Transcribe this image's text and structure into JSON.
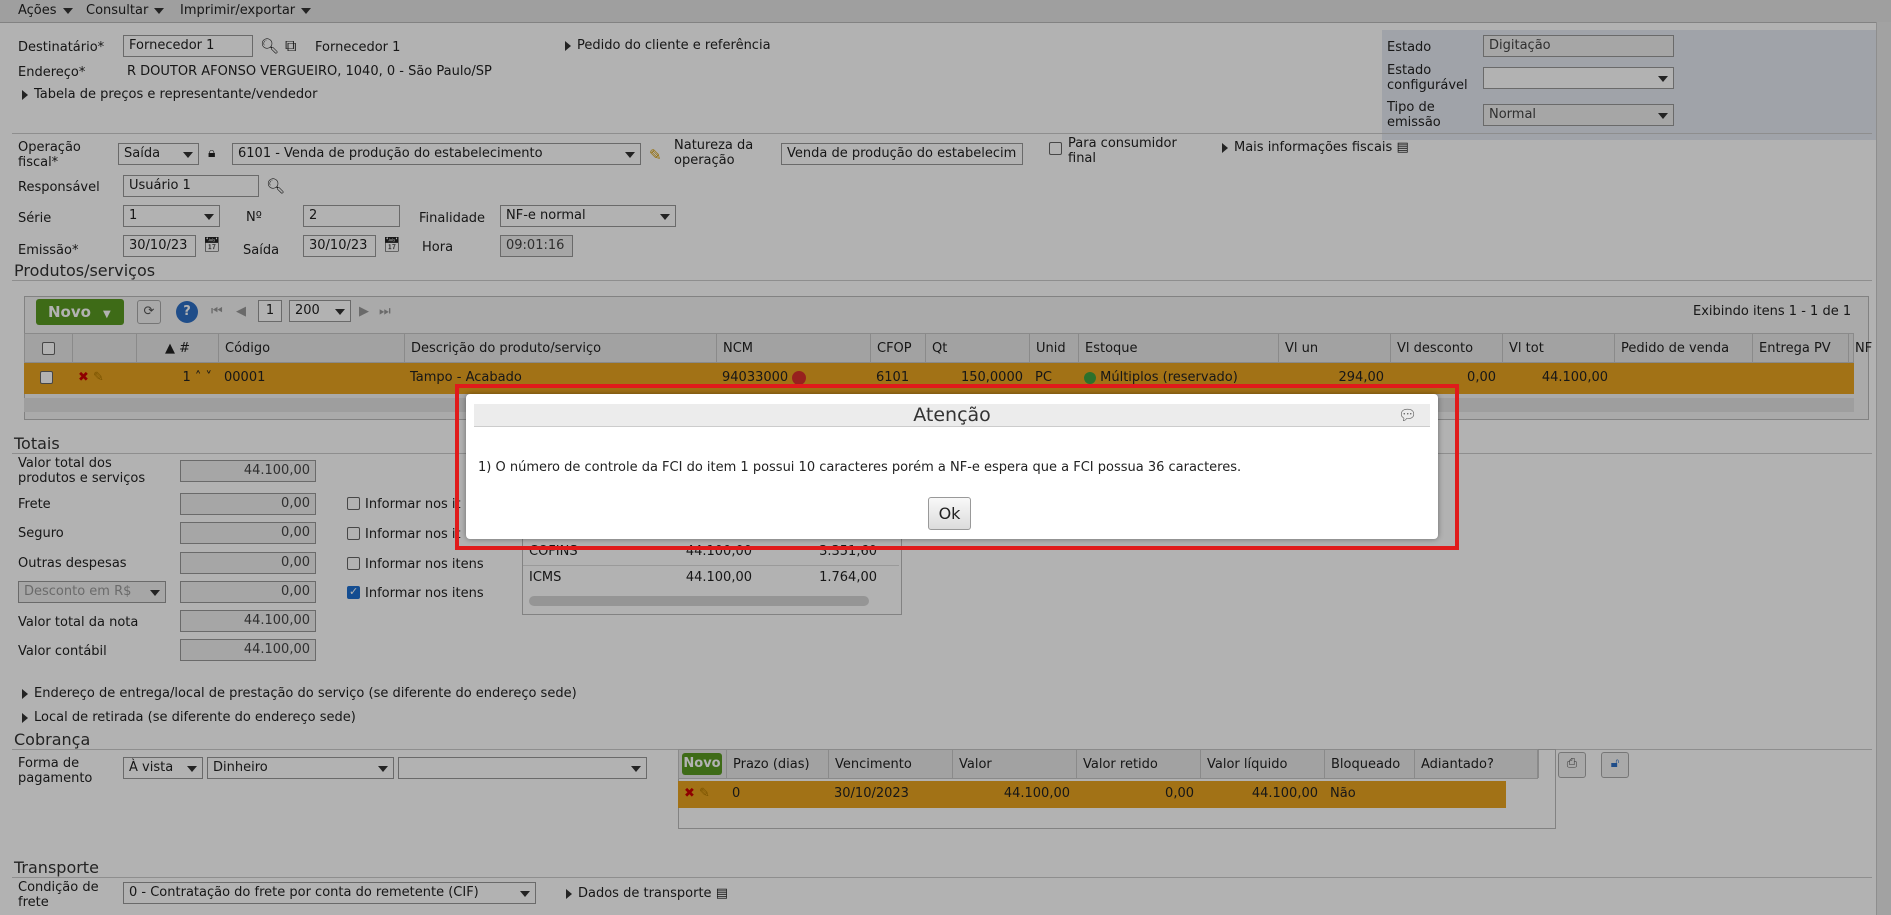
{
  "menu": {
    "acoes": "Ações",
    "consultar": "Consultar",
    "imprimir": "Imprimir/exportar"
  },
  "header": {
    "destinatario_label": "Destinatário*",
    "destinatario_value": "Fornecedor 1",
    "destinatario_link": "Fornecedor 1",
    "pedido_link": "Pedido do cliente e referência",
    "endereco_label": "Endereço*",
    "endereco_value": "R DOUTOR AFONSO VERGUEIRO, 1040, 0 - São Paulo/SP",
    "tabela_link": "Tabela de preços e representante/vendedor",
    "estado_label": "Estado",
    "estado_value": "Digitação",
    "estado_conf_label1": "Estado",
    "estado_conf_label2": "configurável",
    "tipo_emissao_label1": "Tipo de",
    "tipo_emissao_label2": "emissão",
    "tipo_emissao_value": "Normal"
  },
  "fiscal": {
    "operacao_label1": "Operação",
    "operacao_label2": "fiscal*",
    "operacao_value": "Saída",
    "cfop_value": "6101 - Venda de produção do estabelecimento",
    "natureza_label1": "Natureza da",
    "natureza_label2": "operação",
    "natureza_value": "Venda de produção do estabelecim",
    "consumidor_label1": "Para consumidor",
    "consumidor_label2": "final",
    "mais_info": "Mais informações fiscais",
    "responsavel_label": "Responsável",
    "responsavel_value": "Usuário 1",
    "serie_label": "Série",
    "serie_value": "1",
    "numero_label": "Nº",
    "numero_value": "2",
    "finalidade_label": "Finalidade",
    "finalidade_value": "NF-e normal",
    "emissao_label": "Emissão*",
    "emissao_value": "30/10/23",
    "saida_label": "Saída",
    "saida_value": "30/10/23",
    "hora_label": "Hora",
    "hora_value": "09:01:16"
  },
  "produtos": {
    "title": "Produtos/serviços",
    "novo": "Novo",
    "page": "1",
    "page_size": "200",
    "exibindo": "Exibindo itens 1 - 1 de 1",
    "columns": [
      "#",
      "Código",
      "Descrição do produto/serviço",
      "NCM",
      "CFOP",
      "Qt",
      "Unid",
      "Estoque",
      "Vl un",
      "Vl desconto",
      "Vl tot",
      "Pedido de venda",
      "Entrega PV",
      "NF"
    ],
    "row": {
      "num": "1",
      "codigo": "00001",
      "descricao": "Tampo - Acabado",
      "ncm": "94033000",
      "cfop": "6101",
      "qt": "150,0000",
      "unid": "PC",
      "estoque": "Múltiplos (reservado)",
      "vl_un": "294,00",
      "vl_desconto": "0,00",
      "vl_tot": "44.100,00"
    }
  },
  "totais": {
    "title": "Totais",
    "valor_prod_label1": "Valor total dos",
    "valor_prod_label2": "produtos e serviços",
    "valor_prod": "44.100,00",
    "frete_label": "Frete",
    "frete": "0,00",
    "seguro_label": "Seguro",
    "seguro": "0,00",
    "outras_label": "Outras despesas",
    "outras": "0,00",
    "desconto_select": "Desconto em R$",
    "desconto": "0,00",
    "valor_nota_label": "Valor total da nota",
    "valor_nota": "44.100,00",
    "valor_contabil_label": "Valor contábil",
    "valor_contabil": "44.100,00",
    "informar_1": "Informar nos it",
    "informar_2": "Informar nos it",
    "informar_3": "Informar nos itens",
    "informar_4": "Informar nos itens",
    "tax_rows": [
      {
        "tax": "COFINS",
        "base": "44.100,00",
        "valor": "3.351,60"
      },
      {
        "tax": "ICMS",
        "base": "44.100,00",
        "valor": "1.764,00"
      }
    ]
  },
  "links": {
    "entrega": "Endereço de entrega/local de prestação do serviço (se diferente do endereço sede)",
    "retirada": "Local de retirada (se diferente do endereço sede)"
  },
  "cobranca": {
    "title": "Cobrança",
    "forma_label1": "Forma de",
    "forma_label2": "pagamento",
    "forma_value": "À vista",
    "meio_value": "Dinheiro",
    "extra_value": "",
    "novo": "Novo",
    "columns": [
      "Prazo (dias)",
      "Vencimento",
      "Valor",
      "Valor retido",
      "Valor líquido",
      "Bloqueado",
      "Adiantado?"
    ],
    "row": {
      "prazo": "0",
      "vencimento": "30/10/2023",
      "valor": "44.100,00",
      "retido": "0,00",
      "liquido": "44.100,00",
      "bloqueado": "Não",
      "adiantado": ""
    }
  },
  "transporte": {
    "title": "Transporte",
    "condicao_label1": "Condição de",
    "condicao_label2": "frete",
    "condicao_value": "0 - Contratação do frete por conta do remetente (CIF)",
    "dados_link": "Dados de transporte"
  },
  "modal": {
    "title": "Atenção",
    "message": "1) O número de controle da FCI do item 1 possui 10 caracteres porém a NF-e espera que a FCI possua 36 caracteres.",
    "ok": "Ok"
  }
}
